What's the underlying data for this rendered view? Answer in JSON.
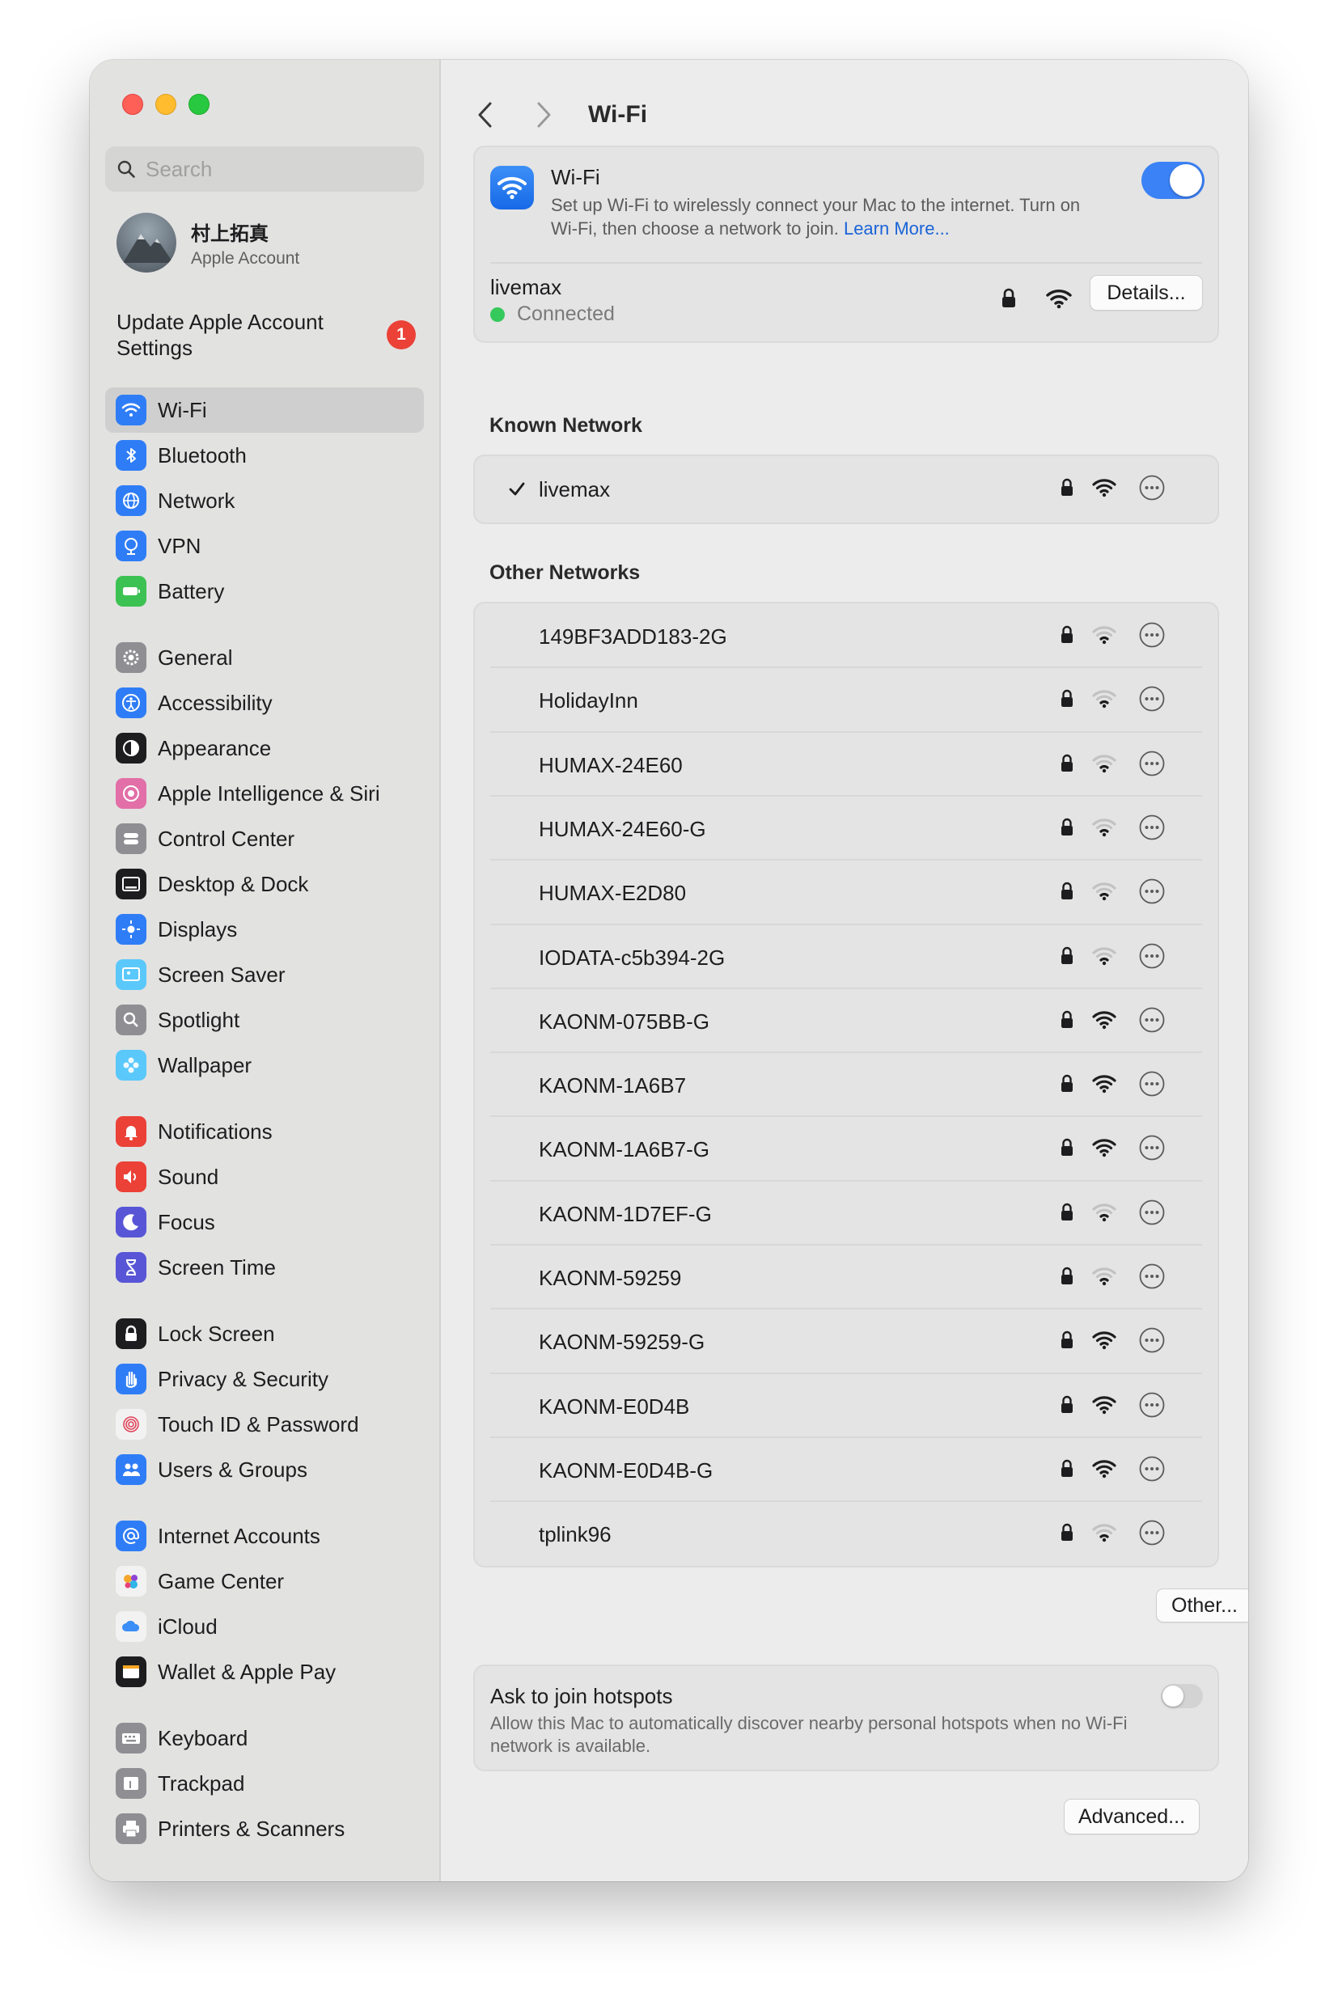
{
  "window": {
    "title": "Wi-Fi"
  },
  "search": {
    "placeholder": "Search"
  },
  "account": {
    "name": "村上拓真",
    "subtitle": "Apple Account"
  },
  "update": {
    "label": "Update Apple Account Settings",
    "badge": "1"
  },
  "sidebar": {
    "groups": [
      [
        {
          "label": "Wi-Fi",
          "icon": "wifi-icon",
          "color": "#2f7df6",
          "selected": true
        },
        {
          "label": "Bluetooth",
          "icon": "bluetooth-icon",
          "color": "#2f7df6"
        },
        {
          "label": "Network",
          "icon": "globe-icon",
          "color": "#2f7df6"
        },
        {
          "label": "VPN",
          "icon": "vpn-icon",
          "color": "#2f7df6"
        },
        {
          "label": "Battery",
          "icon": "battery-icon",
          "color": "#3cc252"
        }
      ],
      [
        {
          "label": "General",
          "icon": "gear-icon",
          "color": "#8e8e93"
        },
        {
          "label": "Accessibility",
          "icon": "accessibility-icon",
          "color": "#2f7df6"
        },
        {
          "label": "Appearance",
          "icon": "appearance-icon",
          "color": "#1d1d1f"
        },
        {
          "label": "Apple Intelligence & Siri",
          "icon": "siri-icon",
          "color": "#e26fa7"
        },
        {
          "label": "Control Center",
          "icon": "control-center-icon",
          "color": "#8e8e93"
        },
        {
          "label": "Desktop & Dock",
          "icon": "dock-icon",
          "color": "#1d1d1f"
        },
        {
          "label": "Displays",
          "icon": "sun-icon",
          "color": "#2f7df6"
        },
        {
          "label": "Screen Saver",
          "icon": "screen-saver-icon",
          "color": "#5ac8fa"
        },
        {
          "label": "Spotlight",
          "icon": "magnifier-icon",
          "color": "#8e8e93"
        },
        {
          "label": "Wallpaper",
          "icon": "flower-icon",
          "color": "#5ac8fa"
        }
      ],
      [
        {
          "label": "Notifications",
          "icon": "bell-icon",
          "color": "#eb4137"
        },
        {
          "label": "Sound",
          "icon": "speaker-icon",
          "color": "#eb4137"
        },
        {
          "label": "Focus",
          "icon": "moon-icon",
          "color": "#5856d6"
        },
        {
          "label": "Screen Time",
          "icon": "hourglass-icon",
          "color": "#5856d6"
        }
      ],
      [
        {
          "label": "Lock Screen",
          "icon": "lock-icon",
          "color": "#1d1d1f"
        },
        {
          "label": "Privacy & Security",
          "icon": "hand-icon",
          "color": "#2f7df6"
        },
        {
          "label": "Touch ID & Password",
          "icon": "fingerprint-icon",
          "color": "#f2f2f2"
        },
        {
          "label": "Users & Groups",
          "icon": "users-icon",
          "color": "#2f7df6"
        }
      ],
      [
        {
          "label": "Internet Accounts",
          "icon": "at-icon",
          "color": "#2f7df6"
        },
        {
          "label": "Game Center",
          "icon": "game-center-icon",
          "color": "#f2f2f2"
        },
        {
          "label": "iCloud",
          "icon": "cloud-icon",
          "color": "#f2f2f2"
        },
        {
          "label": "Wallet & Apple Pay",
          "icon": "wallet-icon",
          "color": "#1d1d1f"
        }
      ],
      [
        {
          "label": "Keyboard",
          "icon": "keyboard-icon",
          "color": "#8e8e93"
        },
        {
          "label": "Trackpad",
          "icon": "trackpad-icon",
          "color": "#8e8e93"
        },
        {
          "label": "Printers & Scanners",
          "icon": "printer-icon",
          "color": "#8e8e93"
        }
      ]
    ]
  },
  "wifi": {
    "title": "Wi-Fi",
    "description": "Set up Wi-Fi to wirelessly connect your Mac to the internet. Turn on Wi-Fi, then choose a network to join.",
    "learn_more": "Learn More...",
    "enabled": true,
    "current_network": "livemax",
    "status": "Connected",
    "details_label": "Details..."
  },
  "known": {
    "title": "Known Network",
    "networks": [
      {
        "ssid": "livemax",
        "connected": true,
        "strength": "full"
      }
    ]
  },
  "other": {
    "title": "Other Networks",
    "networks": [
      {
        "ssid": "149BF3ADD183-2G",
        "strength": "weak"
      },
      {
        "ssid": "HolidayInn",
        "strength": "weak"
      },
      {
        "ssid": "HUMAX-24E60",
        "strength": "weak"
      },
      {
        "ssid": "HUMAX-24E60-G",
        "strength": "weak"
      },
      {
        "ssid": "HUMAX-E2D80",
        "strength": "weak"
      },
      {
        "ssid": "IODATA-c5b394-2G",
        "strength": "weak"
      },
      {
        "ssid": "KAONM-075BB-G",
        "strength": "full"
      },
      {
        "ssid": "KAONM-1A6B7",
        "strength": "full"
      },
      {
        "ssid": "KAONM-1A6B7-G",
        "strength": "full"
      },
      {
        "ssid": "KAONM-1D7EF-G",
        "strength": "weak"
      },
      {
        "ssid": "KAONM-59259",
        "strength": "weak"
      },
      {
        "ssid": "KAONM-59259-G",
        "strength": "full"
      },
      {
        "ssid": "KAONM-E0D4B",
        "strength": "full"
      },
      {
        "ssid": "KAONM-E0D4B-G",
        "strength": "full"
      },
      {
        "ssid": "tplink96",
        "strength": "weak"
      }
    ],
    "other_button": "Other..."
  },
  "hotspots": {
    "title": "Ask to join hotspots",
    "description": "Allow this Mac to automatically discover nearby personal hotspots when no Wi-Fi network is available.",
    "enabled": false
  },
  "footer": {
    "advanced_label": "Advanced...",
    "help_label": "?"
  }
}
